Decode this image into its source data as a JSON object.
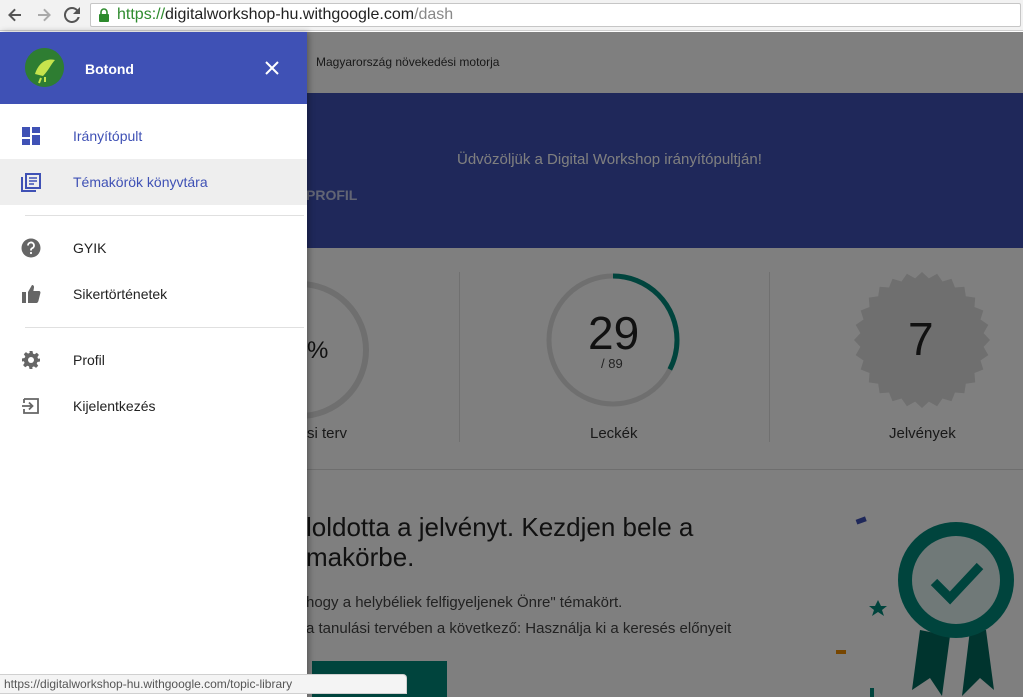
{
  "browser": {
    "url_scheme": "https://",
    "url_host": "digitalworkshop-hu.withgoogle.com",
    "url_path": "/dash",
    "status_url": "https://digitalworkshop-hu.withgoogle.com/topic-library"
  },
  "page": {
    "tagline": "Magyarország növekedési motorja",
    "welcome": "Üdvözöljük a Digital Workshop irányítópultján!",
    "profile_tab": "PROFIL",
    "stats": {
      "plan_percent_suffix": "%",
      "plan_label": "si terv",
      "lessons_done": "29",
      "lessons_total": "/ 89",
      "lessons_progress": 0.326,
      "lessons_label": "Leckék",
      "badges_count": "7",
      "badges_label": "Jelvények"
    },
    "headline": "loldotta a jelvényt. Kezdjen bele a makörbe.",
    "desc_line1": "hogy a helybéliek felfigyeljenek Önre\" témakört.",
    "desc_line2": "a tanulási tervében a következő: Használja ki a keresés előnyeit"
  },
  "drawer": {
    "username": "Botond",
    "items": [
      {
        "label": "Irányítópult",
        "icon": "dashboard-icon"
      },
      {
        "label": "Témakörök könyvtára",
        "icon": "library-icon"
      },
      {
        "label": "GYIK",
        "icon": "help-icon"
      },
      {
        "label": "Sikertörténetek",
        "icon": "thumb-up-icon"
      },
      {
        "label": "Profil",
        "icon": "gear-icon"
      },
      {
        "label": "Kijelentkezés",
        "icon": "logout-icon"
      }
    ]
  },
  "colors": {
    "primary": "#3f51b5",
    "accent": "#00897b",
    "scrim": "rgba(0,0,0,0.5)"
  }
}
